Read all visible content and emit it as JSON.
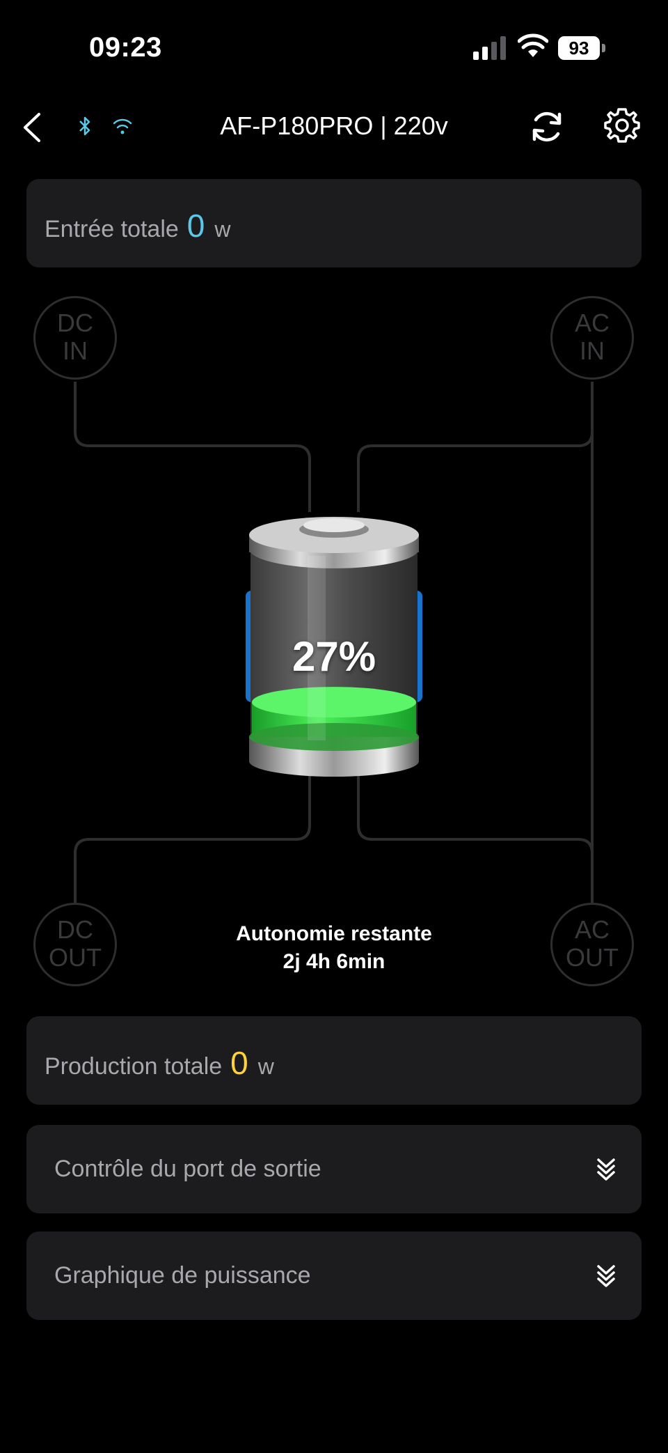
{
  "status_bar": {
    "time": "09:23",
    "battery": "93"
  },
  "header": {
    "title": "AF-P180PRO | 220v"
  },
  "input_card": {
    "label": "Entrée totale",
    "value": "0",
    "unit": "w",
    "value_color": "#5ac8e6"
  },
  "ports": {
    "dc_in": [
      "DC",
      "IN"
    ],
    "ac_in": [
      "AC",
      "IN"
    ],
    "dc_out": [
      "DC",
      "OUT"
    ],
    "ac_out": [
      "AC",
      "OUT"
    ]
  },
  "battery": {
    "percent_label": "27%",
    "level": 0.27,
    "fill_color": "#2ecc40"
  },
  "autonomy": {
    "label": "Autonomie restante",
    "value": "2j 4h 6min"
  },
  "output_card": {
    "label": "Production totale",
    "value": "0",
    "unit": "w",
    "value_color": "#ffd23a"
  },
  "sections": {
    "port_control": "Contrôle du port de sortie",
    "power_graph": "Graphique de puissance"
  },
  "icons": [
    "chevron-left-icon",
    "bluetooth-icon",
    "wifi-icon",
    "refresh-icon",
    "gear-icon",
    "double-chevron-down-icon"
  ]
}
